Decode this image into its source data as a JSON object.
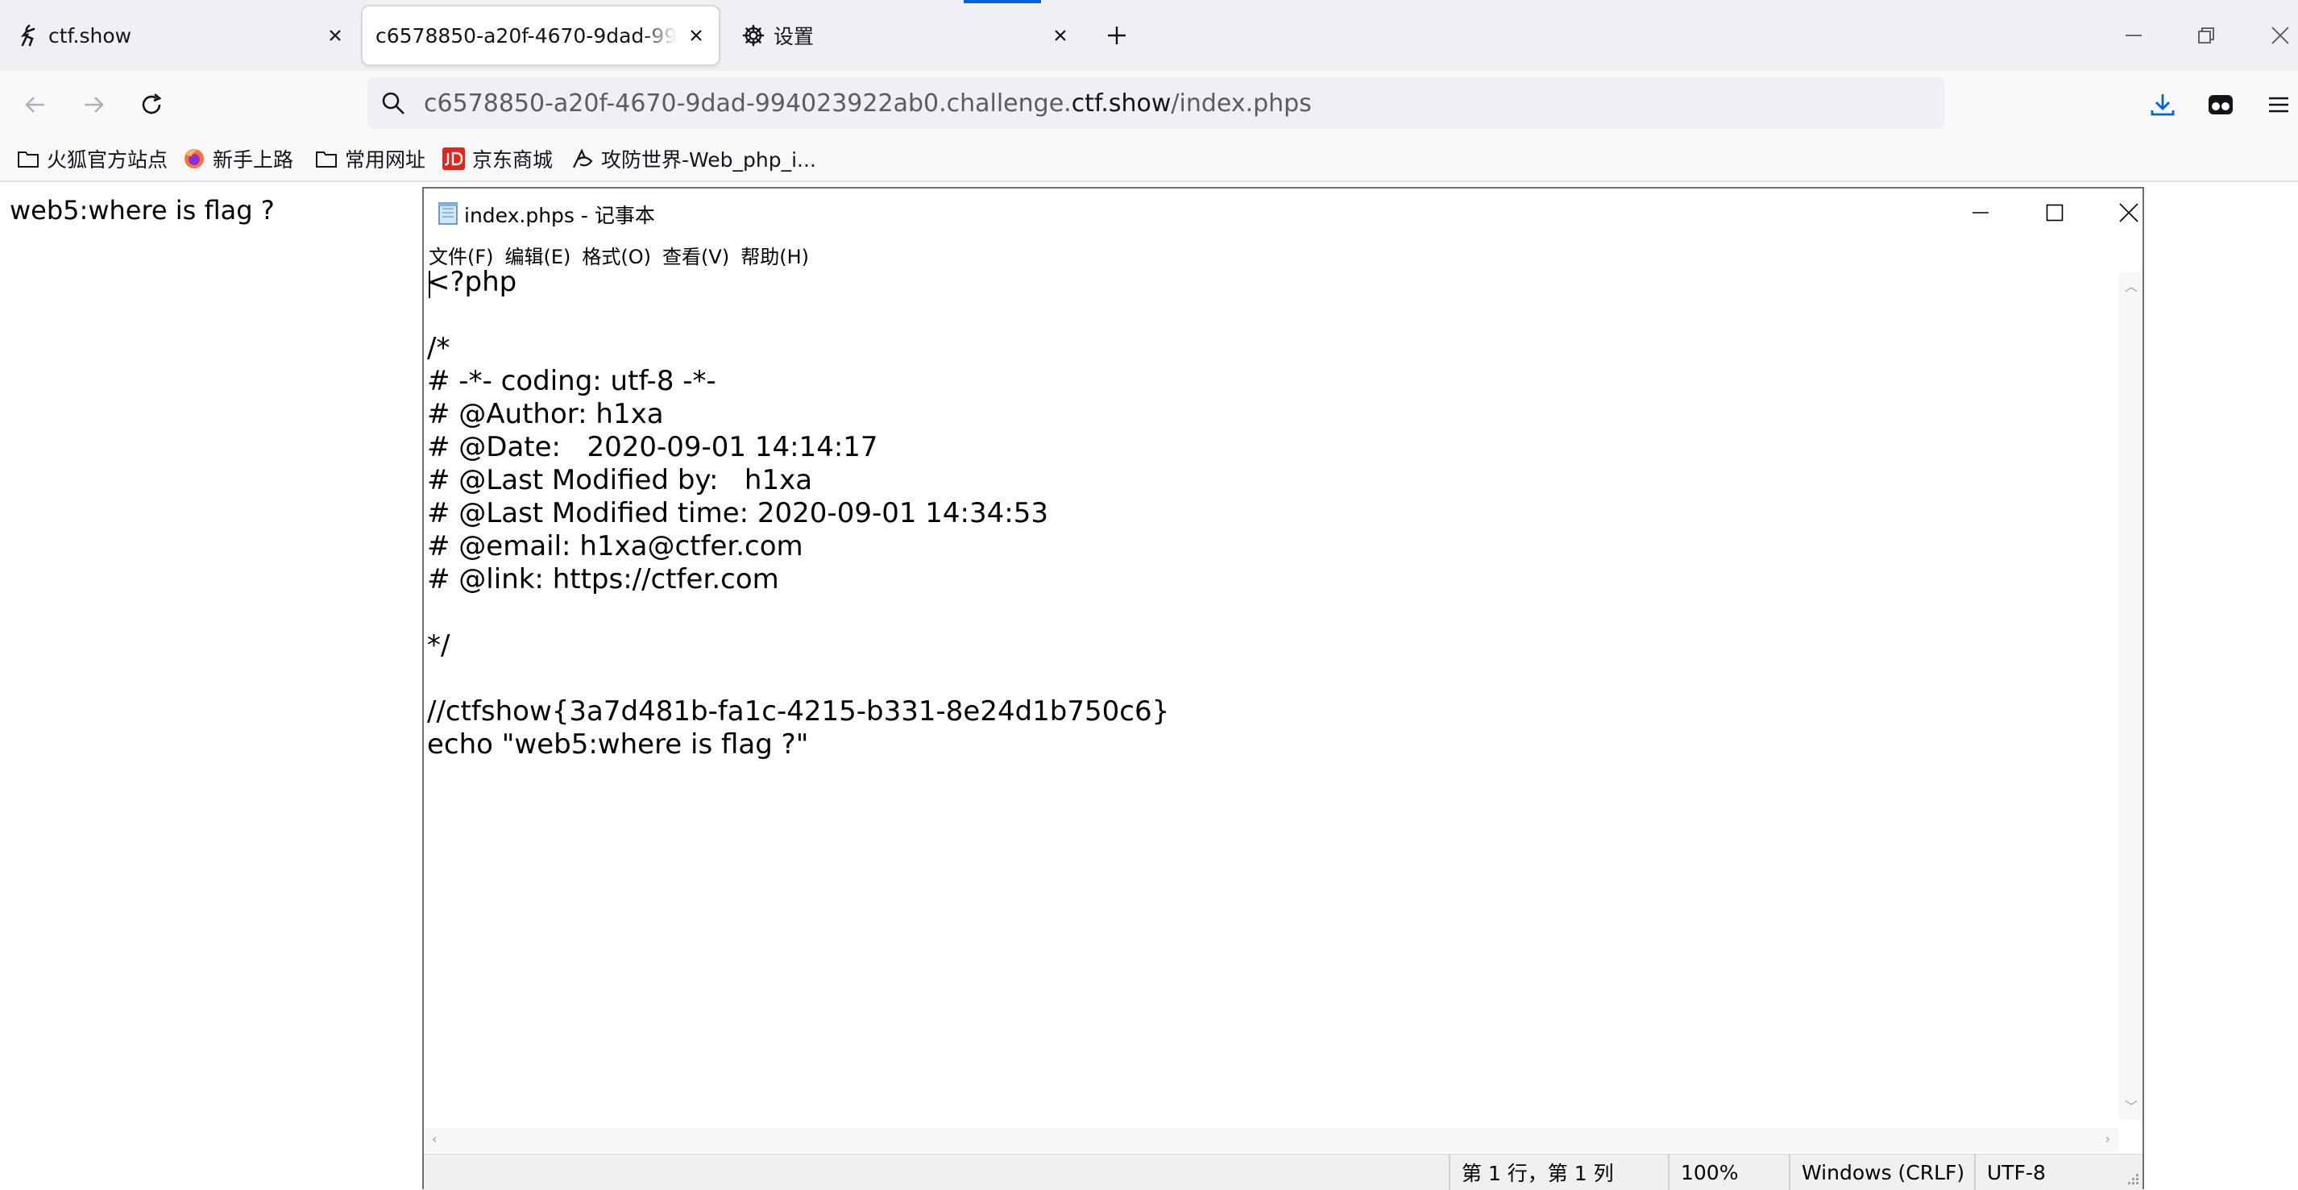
{
  "browser": {
    "tabs": [
      {
        "label": "ctf.show",
        "active": false
      },
      {
        "label": "c6578850-a20f-4670-9dad-994023922ab0.challenge.ctf.show/index.phps",
        "active": true
      },
      {
        "label": "设置",
        "active": false
      }
    ],
    "url": {
      "prefix": "c6578850-a20f-4670-9dad-994023922ab0.challenge.",
      "host": "ctf.show",
      "path": "/index.phps"
    },
    "bookmarks": [
      {
        "label": "火狐官方站点",
        "icon": "folder-icon"
      },
      {
        "label": "新手上路",
        "icon": "firefox-icon"
      },
      {
        "label": "常用网址",
        "icon": "folder-icon"
      },
      {
        "label": "京东商城",
        "icon": "jd-icon"
      },
      {
        "label": "攻防世界-Web_php_i...",
        "icon": "site-icon"
      }
    ],
    "accent_color": "#0061e0"
  },
  "page": {
    "text": "web5:where is flag ?"
  },
  "notepad": {
    "title": "index.phps - 记事本",
    "menu": [
      "文件(F)",
      "编辑(E)",
      "格式(O)",
      "查看(V)",
      "帮助(H)"
    ],
    "content": "<?php\n\n/*\n# -*- coding: utf-8 -*-\n# @Author: h1xa\n# @Date:   2020-09-01 14:14:17\n# @Last Modified by:   h1xa\n# @Last Modified time: 2020-09-01 14:34:53\n# @email: h1xa@ctfer.com\n# @link: https://ctfer.com\n\n*/\n\n//ctfshow{3a7d481b-fa1c-4215-b331-8e24d1b750c6}\necho \"web5:where is flag ?\"",
    "status": {
      "position": "第 1 行，第 1 列",
      "zoom": "100%",
      "line_ending": "Windows (CRLF)",
      "encoding": "UTF-8"
    }
  }
}
